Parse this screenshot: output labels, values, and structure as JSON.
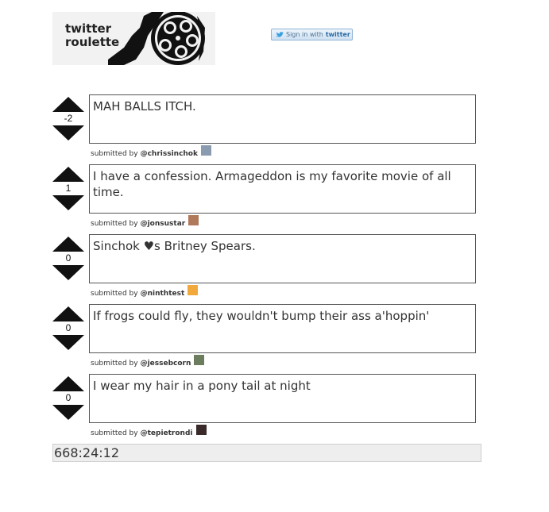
{
  "logo": {
    "line1": "twitter",
    "line2": "roulette"
  },
  "signin": {
    "prefix": "Sign in with",
    "brand": "twitter"
  },
  "posts": [
    {
      "score": "-2",
      "text": "MAH BALLS ITCH.",
      "by_label": "submitted by",
      "user": "@chrissinchok",
      "avatar_color": "#8a9bb0"
    },
    {
      "score": "1",
      "text": "I have a confession. Armageddon is my favorite movie of all time.",
      "by_label": "submitted by",
      "user": "@jonsustar",
      "avatar_color": "#b07a5a"
    },
    {
      "score": "0",
      "text": "Sinchok ♥s Britney Spears.",
      "by_label": "submitted by",
      "user": "@ninthtest",
      "avatar_color": "#f2a93b"
    },
    {
      "score": "0",
      "text": "If frogs could fly, they wouldn't bump their ass a'hoppin'",
      "by_label": "submitted by",
      "user": "@jessebcorn",
      "avatar_color": "#6b7d5c"
    },
    {
      "score": "0",
      "text": "I wear my hair in a pony tail at night",
      "by_label": "submitted by",
      "user": "@tepietrondi",
      "avatar_color": "#3a2a2a"
    }
  ],
  "timer": "668:24:12"
}
